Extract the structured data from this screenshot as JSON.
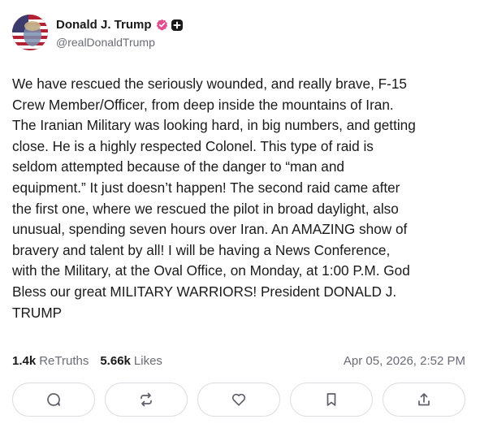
{
  "author": {
    "display_name": "Donald J. Trump",
    "handle": "@realDonaldTrump",
    "verified_color": "#e0508f"
  },
  "post": {
    "text": "We have rescued the seriously wounded, and really brave, F-15\nCrew Member/Officer, from deep inside the mountains of Iran.\nThe Iranian Military was looking hard, in big numbers, and getting\nclose. He is a highly respected Colonel. This type of raid is\nseldom attempted because of the danger to “man and\nequipment.” It just doesn’t happen! The second raid came after\nthe first one, where we rescued the pilot in broad daylight, also\nunusual, spending seven hours over Iran. An AMAZING show of\nbravery and talent by all! I will be having a News Conference,\nwith the Military, at the Oval Office, on Monday, at 1:00 P.M. God\nBless our great MILITARY WARRIORS! President DONALD J.\nTRUMP",
    "timestamp": "Apr 05, 2026, 2:52 PM"
  },
  "stats": {
    "retruths_count": "1.4k",
    "retruths_label": "ReTruths",
    "likes_count": "5.66k",
    "likes_label": "Likes"
  },
  "actions": [
    {
      "icon": "reply-icon"
    },
    {
      "icon": "retruth-icon"
    },
    {
      "icon": "heart-icon"
    },
    {
      "icon": "bookmark-icon"
    },
    {
      "icon": "share-icon"
    }
  ]
}
